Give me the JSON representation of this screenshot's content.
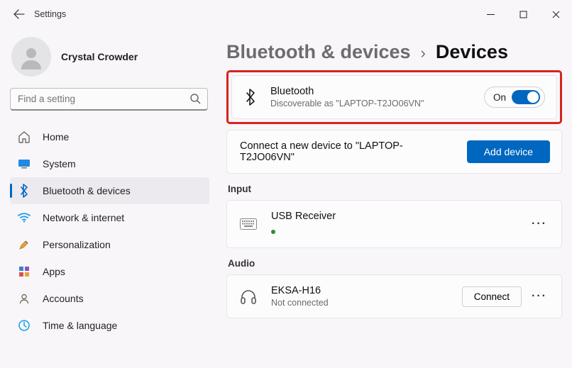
{
  "window": {
    "title": "Settings"
  },
  "user": {
    "name": "Crystal Crowder"
  },
  "search": {
    "placeholder": "Find a setting"
  },
  "nav": {
    "home": "Home",
    "system": "System",
    "bt": "Bluetooth & devices",
    "network": "Network & internet",
    "personal": "Personalization",
    "apps": "Apps",
    "accounts": "Accounts",
    "time": "Time & language"
  },
  "header": {
    "crumb1": "Bluetooth & devices",
    "crumb2": "Devices"
  },
  "bt": {
    "title": "Bluetooth",
    "subtitle": "Discoverable as \"LAPTOP-T2JO06VN\"",
    "toggle_label": "On"
  },
  "adddev": {
    "text": "Connect a new device to \"LAPTOP-T2JO06VN\"",
    "button": "Add device"
  },
  "sections": {
    "input": "Input",
    "audio": "Audio"
  },
  "input_dev": {
    "name": "USB Receiver"
  },
  "audio_dev": {
    "name": "EKSA-H16",
    "status": "Not connected",
    "connect": "Connect"
  }
}
